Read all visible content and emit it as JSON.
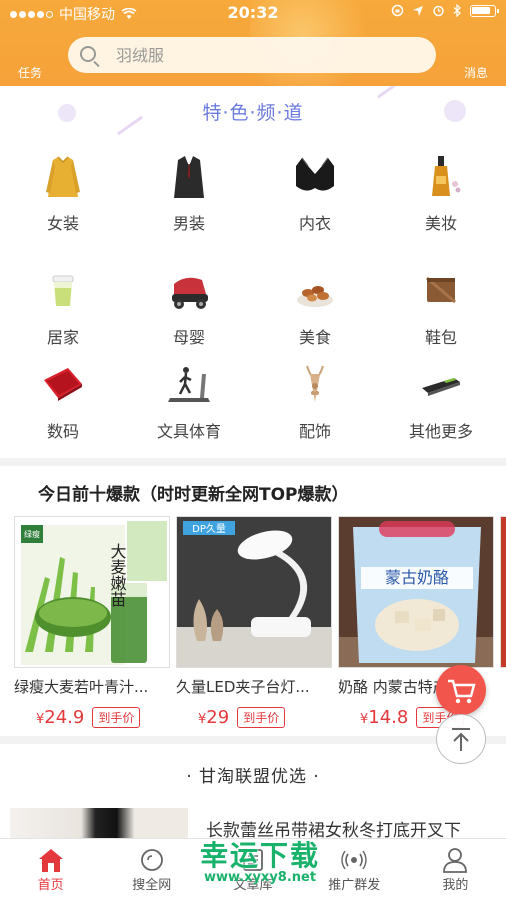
{
  "status_bar": {
    "carrier": "中国移动",
    "time": "20:32"
  },
  "header": {
    "task_label": "任务",
    "message_label": "消息",
    "search_placeholder": "羽绒服",
    "bg_color": "#f5a23a"
  },
  "channels": {
    "title": "特·色·频·道",
    "items": [
      {
        "label": "女装",
        "icon": "sweater-icon"
      },
      {
        "label": "男装",
        "icon": "suit-icon"
      },
      {
        "label": "内衣",
        "icon": "bra-icon"
      },
      {
        "label": "美妆",
        "icon": "perfume-icon"
      },
      {
        "label": "居家",
        "icon": "cup-icon"
      },
      {
        "label": "母婴",
        "icon": "baby-car-icon"
      },
      {
        "label": "美食",
        "icon": "nuts-icon"
      },
      {
        "label": "鞋包",
        "icon": "wallet-icon"
      },
      {
        "label": "数码",
        "icon": "tablet-icon"
      },
      {
        "label": "文具体育",
        "icon": "treadmill-icon"
      },
      {
        "label": "配饰",
        "icon": "necklace-icon"
      },
      {
        "label": "其他更多",
        "icon": "lighter-icon"
      }
    ]
  },
  "top_ten": {
    "title": "今日前十爆款（时时更新全网TOP爆款）",
    "products": [
      {
        "name": "绿瘦大麦若叶青汁...",
        "currency": "¥",
        "price": "24.9",
        "button": "到手价",
        "badge": "绿瘦",
        "pkg_text": "大麦嫩苗"
      },
      {
        "name": "久量LED夹子台灯...",
        "currency": "¥",
        "price": "29",
        "button": "到手价",
        "badge": "DP久量"
      },
      {
        "name": "奶酪 内蒙古特产...",
        "currency": "¥",
        "price": "14.8",
        "button": "到手价",
        "pkg_text": "蒙古奶酪"
      }
    ]
  },
  "alliance": {
    "title": "· 甘淘联盟优选 ·",
    "first_item_name": "长款蕾丝吊带裙女秋冬打底开叉下"
  },
  "tabbar": {
    "items": [
      {
        "label": "首页",
        "active": true
      },
      {
        "label": "搜全网",
        "active": false
      },
      {
        "label": "文章库",
        "active": false
      },
      {
        "label": "推广群发",
        "active": false
      },
      {
        "label": "我的",
        "active": false
      }
    ],
    "active_color": "#e4393c"
  },
  "watermark": {
    "main": "幸运下载",
    "url": "www.xyxy8.net"
  }
}
